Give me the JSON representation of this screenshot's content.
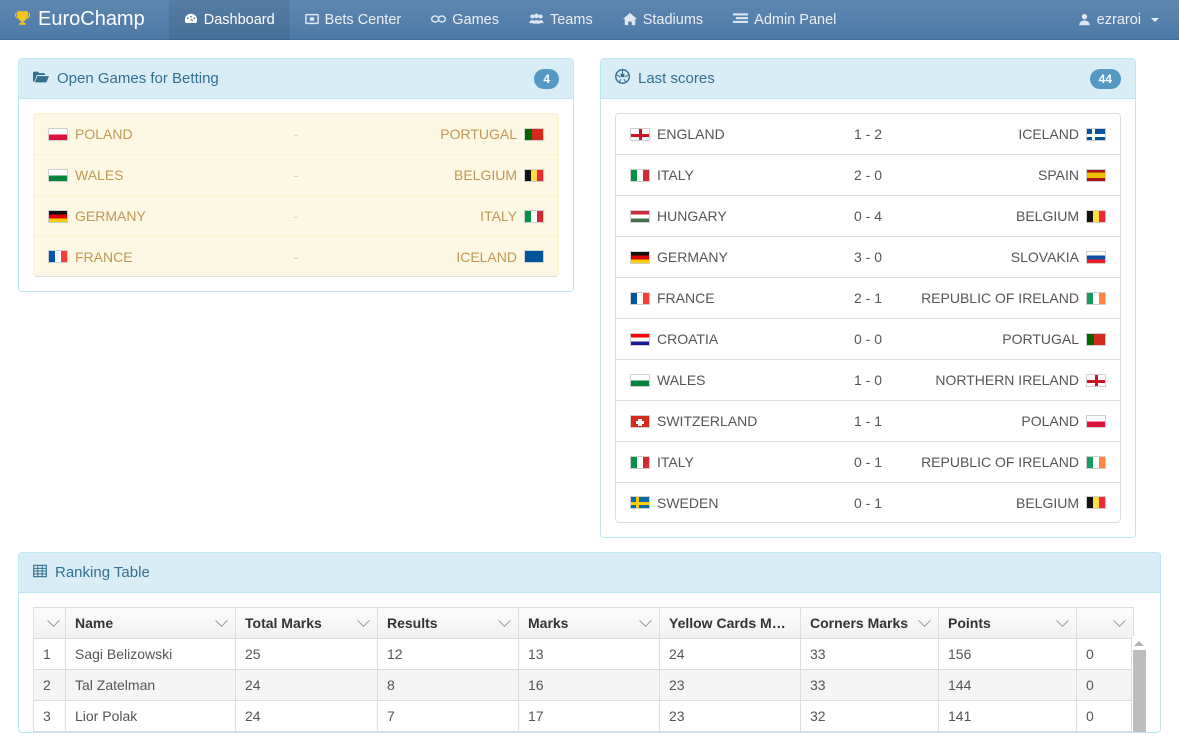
{
  "navbar": {
    "brand": {
      "label": "EuroChamp",
      "icon": "trophy-icon"
    },
    "items": [
      {
        "label": "Dashboard",
        "icon": "dashboard-icon",
        "active": true
      },
      {
        "label": "Bets Center",
        "icon": "bets-icon",
        "active": false
      },
      {
        "label": "Games",
        "icon": "games-icon",
        "active": false
      },
      {
        "label": "Teams",
        "icon": "teams-icon",
        "active": false
      },
      {
        "label": "Stadiums",
        "icon": "home-icon",
        "active": false
      },
      {
        "label": "Admin Panel",
        "icon": "admin-icon",
        "active": false
      }
    ],
    "user": {
      "label": "ezraroi",
      "icon": "user-icon"
    }
  },
  "open_games_panel": {
    "title": "Open Games for Betting",
    "icon": "folder-open-icon",
    "badge": "4",
    "rows": [
      {
        "home": "POLAND",
        "home_flag": "pl",
        "score": "-",
        "away": "PORTUGAL",
        "away_flag": "pt"
      },
      {
        "home": "WALES",
        "home_flag": "wal",
        "score": "-",
        "away": "BELGIUM",
        "away_flag": "be"
      },
      {
        "home": "GERMANY",
        "home_flag": "de",
        "score": "-",
        "away": "ITALY",
        "away_flag": "it"
      },
      {
        "home": "FRANCE",
        "home_flag": "fr",
        "score": "-",
        "away": "ICELAND",
        "away_flag": "is"
      }
    ]
  },
  "last_scores_panel": {
    "title": "Last scores",
    "icon": "soccer-ball-icon",
    "badge": "44",
    "rows": [
      {
        "home": "ENGLAND",
        "home_flag": "en",
        "score": "1 - 2",
        "away": "ICELAND",
        "away_flag": "is"
      },
      {
        "home": "ITALY",
        "home_flag": "it",
        "score": "2 - 0",
        "away": "SPAIN",
        "away_flag": "es"
      },
      {
        "home": "HUNGARY",
        "home_flag": "hu",
        "score": "0 - 4",
        "away": "BELGIUM",
        "away_flag": "be"
      },
      {
        "home": "GERMANY",
        "home_flag": "de",
        "score": "3 - 0",
        "away": "SLOVAKIA",
        "away_flag": "sk"
      },
      {
        "home": "FRANCE",
        "home_flag": "fr",
        "score": "2 - 1",
        "away": "REPUBLIC OF IRELAND",
        "away_flag": "ie"
      },
      {
        "home": "CROATIA",
        "home_flag": "hr",
        "score": "0 - 0",
        "away": "PORTUGAL",
        "away_flag": "pt"
      },
      {
        "home": "WALES",
        "home_flag": "wal",
        "score": "1 - 0",
        "away": "NORTHERN IRELAND",
        "away_flag": "nir"
      },
      {
        "home": "SWITZERLAND",
        "home_flag": "ch",
        "score": "1 - 1",
        "away": "POLAND",
        "away_flag": "pl"
      },
      {
        "home": "ITALY",
        "home_flag": "it",
        "score": "0 - 1",
        "away": "REPUBLIC OF IRELAND",
        "away_flag": "ie"
      },
      {
        "home": "SWEDEN",
        "home_flag": "se",
        "score": "0 - 1",
        "away": "BELGIUM",
        "away_flag": "be"
      }
    ]
  },
  "ranking_panel": {
    "title": "Ranking Table",
    "icon": "table-grid-icon",
    "columns": [
      {
        "label": "",
        "chevron": true
      },
      {
        "label": "Name",
        "chevron": true
      },
      {
        "label": "Total Marks",
        "chevron": true
      },
      {
        "label": "Results",
        "chevron": true
      },
      {
        "label": "Marks",
        "chevron": true
      },
      {
        "label": "Yellow Cards Mar...",
        "chevron": true
      },
      {
        "label": "Corners Marks",
        "chevron": true
      },
      {
        "label": "Points",
        "chevron": true
      },
      {
        "label": "",
        "chevron": true
      }
    ],
    "rows": [
      {
        "rank": "1",
        "name": "Sagi Belizowski",
        "total_marks": "25",
        "results": "12",
        "marks": "13",
        "yellow_cards_marks": "24",
        "corners_marks": "33",
        "points": "156",
        "last": "0"
      },
      {
        "rank": "2",
        "name": "Tal Zatelman",
        "total_marks": "24",
        "results": "8",
        "marks": "16",
        "yellow_cards_marks": "23",
        "corners_marks": "33",
        "points": "144",
        "last": "0"
      },
      {
        "rank": "3",
        "name": "Lior Polak",
        "total_marks": "24",
        "results": "7",
        "marks": "17",
        "yellow_cards_marks": "23",
        "corners_marks": "32",
        "points": "141",
        "last": "0"
      }
    ]
  },
  "colors": {
    "navbar": "#4e7aa7",
    "panel_border": "#bce8f1",
    "panel_heading_bg": "#d9edf7",
    "panel_heading_text": "#31708f",
    "badge": "#5598c4",
    "warning_bg": "#fcf8e3",
    "warning_text": "#c09853",
    "trophy": "#f2c521"
  }
}
